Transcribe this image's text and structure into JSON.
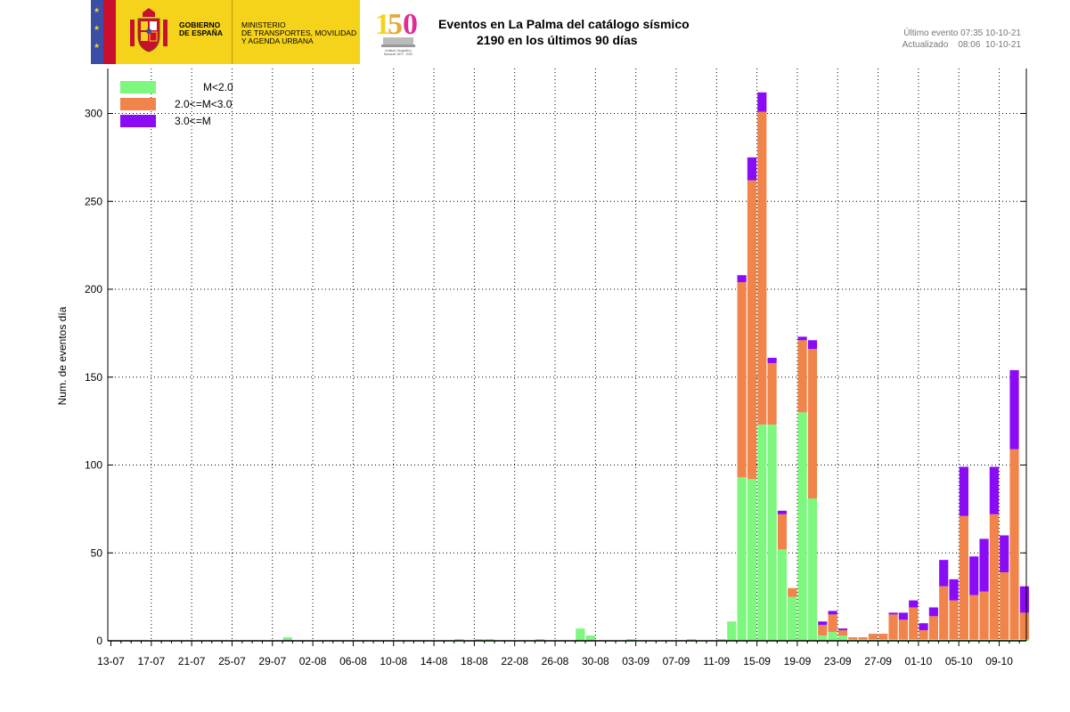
{
  "header": {
    "gov_line1": "GOBIERNO",
    "gov_line2": "DE ESPAÑA",
    "ministry_line1": "MINISTERIO",
    "ministry_line2": "DE TRANSPORTES, MOVILIDAD",
    "ministry_line3": "Y AGENDA URBANA",
    "logo_number": "150",
    "logo_caption": "Instituto Geográfico Nacional 1870 - 2020",
    "title_line1": "Eventos en La Palma del catálogo sísmico",
    "title_line2": "2190 en los últimos 90 días",
    "last_event": "Último evento 07:35 10-10-21",
    "updated": "Actualizado    08:06  10-10-21"
  },
  "colors": {
    "m_lt_2": "#7ef77e",
    "m_2_3": "#f0844a",
    "m_ge_3": "#8a0cf5",
    "gov_yellow": "#f6d31b"
  },
  "chart_data": {
    "type": "bar",
    "stacked": true,
    "ylabel": "Num. de eventos día",
    "xlabel": "",
    "ylim": [
      0,
      320
    ],
    "yticks": [
      0,
      50,
      100,
      150,
      200,
      250,
      300
    ],
    "grid": true,
    "legend_position": "top-left",
    "x_tick_labels": [
      "13-07",
      "17-07",
      "21-07",
      "25-07",
      "29-07",
      "02-08",
      "06-08",
      "10-08",
      "14-08",
      "18-08",
      "22-08",
      "26-08",
      "30-08",
      "03-09",
      "07-09",
      "11-09",
      "15-09",
      "19-09",
      "23-09",
      "27-09",
      "01-10",
      "05-10",
      "09-10"
    ],
    "first_date": "13-07",
    "series": [
      {
        "name": "M<2.0",
        "color": "#7ef77e",
        "values": [
          0,
          0,
          0,
          0,
          0,
          0,
          0,
          0,
          0,
          0,
          0,
          0,
          0,
          0,
          0,
          0,
          0,
          2,
          0,
          0,
          0,
          0,
          0,
          0,
          0,
          0,
          0,
          0,
          0,
          0,
          0,
          0,
          0,
          0,
          1,
          0,
          1,
          1,
          0,
          0,
          0,
          0,
          1,
          0,
          0,
          0,
          7,
          3,
          0,
          0,
          0,
          1,
          0,
          0,
          0,
          0,
          0,
          1,
          0,
          0,
          1,
          11,
          93,
          92,
          123,
          123,
          52,
          25,
          130,
          81,
          3,
          5,
          3,
          1,
          1,
          1,
          1,
          1,
          1,
          1,
          1,
          1,
          1,
          1,
          1,
          1,
          1,
          1,
          1,
          1,
          1
        ]
      },
      {
        "name": "2.0<=M<3.0",
        "color": "#f0844a",
        "values": [
          0,
          0,
          0,
          0,
          0,
          0,
          0,
          0,
          0,
          0,
          0,
          0,
          0,
          0,
          0,
          0,
          0,
          0,
          0,
          0,
          0,
          0,
          0,
          0,
          0,
          0,
          0,
          0,
          0,
          0,
          0,
          0,
          0,
          0,
          0,
          0,
          0,
          0,
          0,
          0,
          0,
          0,
          0,
          0,
          0,
          0,
          0,
          0,
          0,
          0,
          0,
          0,
          0,
          0,
          0,
          0,
          0,
          0,
          0,
          0,
          0,
          0,
          111,
          170,
          178,
          35,
          20,
          5,
          41,
          85,
          6,
          10,
          3,
          1,
          1,
          3,
          3,
          14,
          11,
          18,
          5,
          13,
          30,
          22,
          70,
          25,
          27,
          71,
          38,
          108,
          15
        ]
      },
      {
        "name": "3.0<=M",
        "color": "#8a0cf5",
        "values": [
          0,
          0,
          0,
          0,
          0,
          0,
          0,
          0,
          0,
          0,
          0,
          0,
          0,
          0,
          0,
          0,
          0,
          0,
          0,
          0,
          0,
          0,
          0,
          0,
          0,
          0,
          0,
          0,
          0,
          0,
          0,
          0,
          0,
          0,
          0,
          0,
          0,
          0,
          0,
          0,
          0,
          0,
          0,
          0,
          0,
          0,
          0,
          0,
          0,
          0,
          0,
          0,
          0,
          0,
          0,
          0,
          0,
          0,
          0,
          0,
          0,
          0,
          4,
          13,
          11,
          3,
          2,
          0,
          2,
          5,
          2,
          2,
          1,
          0,
          0,
          0,
          0,
          1,
          4,
          4,
          4,
          5,
          15,
          12,
          28,
          22,
          30,
          27,
          21,
          45,
          15
        ]
      }
    ]
  }
}
